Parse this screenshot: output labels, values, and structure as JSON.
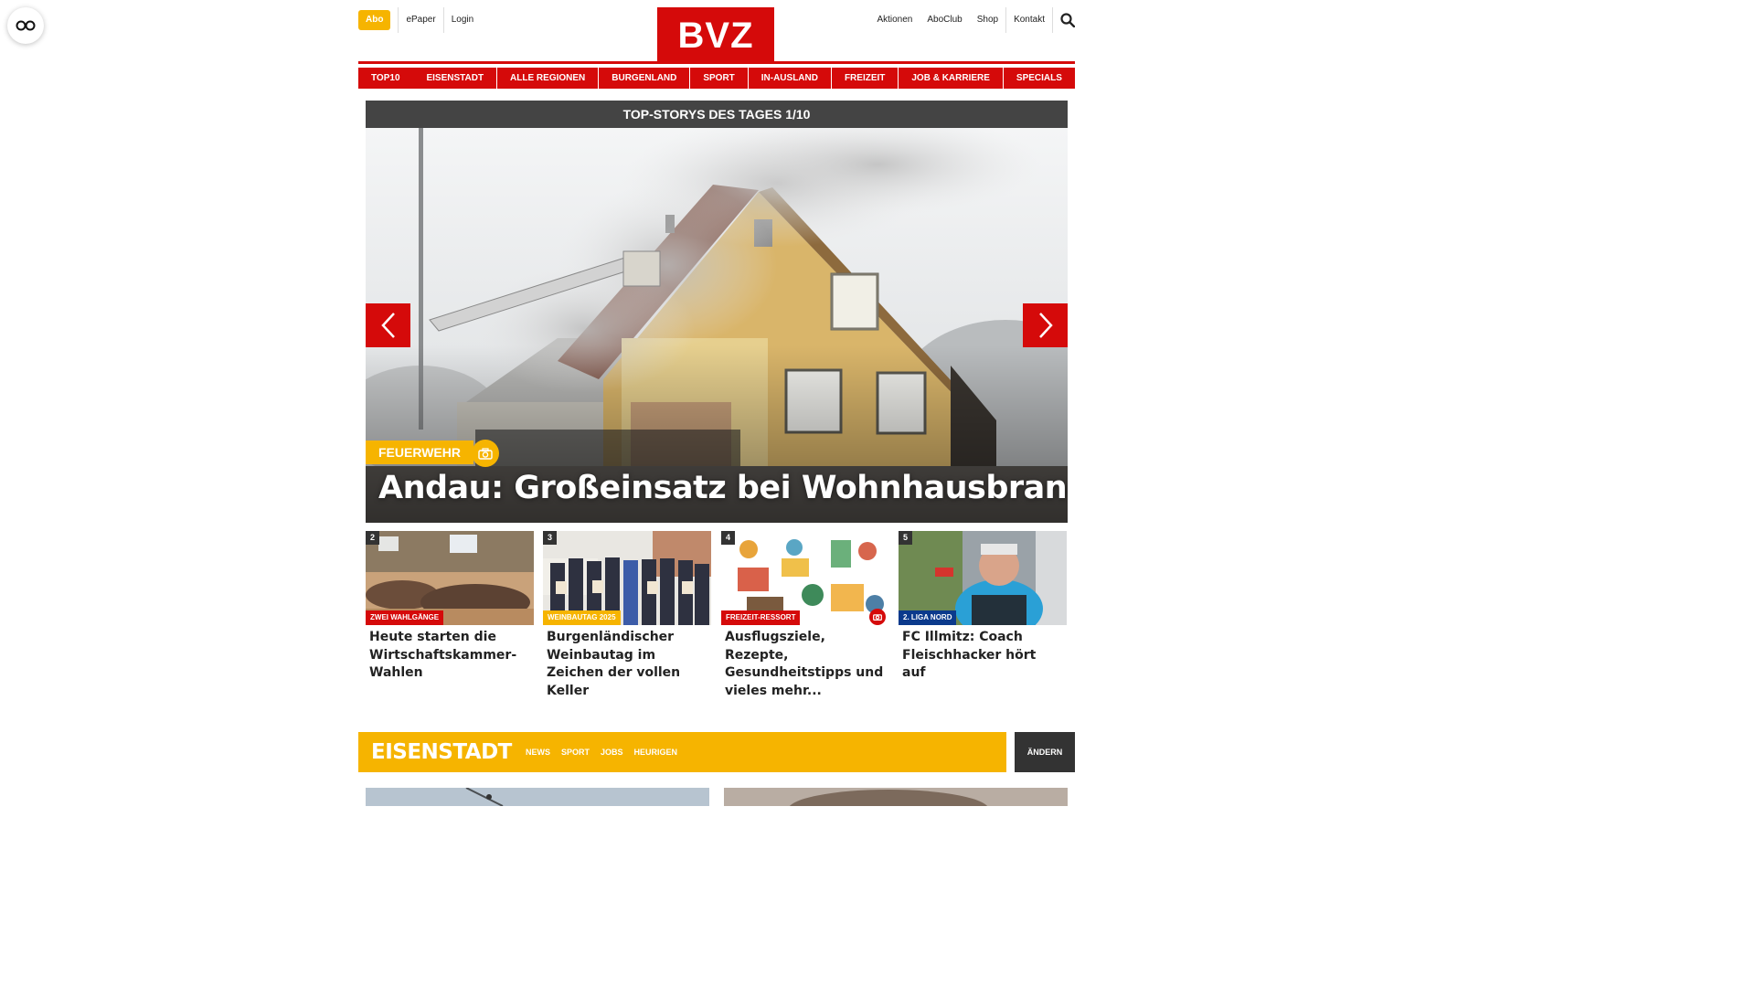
{
  "header": {
    "abo_label": "Abo",
    "epaper_label": "ePaper",
    "login_label": "Login",
    "logo_text": "BVZ",
    "right_links": [
      "Aktionen",
      "AboClub",
      "Shop",
      "Kontakt"
    ]
  },
  "nav": {
    "items": [
      "TOP10",
      "EISENSTADT",
      "ALLE REGIONEN",
      "BURGENLAND",
      "SPORT",
      "IN-AUSLAND",
      "FREIZEIT",
      "JOB & KARRIERE",
      "SPECIALS"
    ]
  },
  "topstories": {
    "heading": "TOP-STORYS DES TAGES 1/10",
    "hero": {
      "category": "FEUERWEHR",
      "title": "Andau: Großeinsatz bei Wohnhausbrand",
      "camera_icon": "camera-icon"
    },
    "teasers": [
      {
        "num": "2",
        "category": "ZWEI WAHLGÄNGE",
        "cat_color": "#d50a0a",
        "title": "Heute starten die Wirtschaftskammer-Wahlen"
      },
      {
        "num": "3",
        "category": "WEINBAUTAG 2025",
        "cat_color": "#f6b400",
        "title": "Burgenländischer Weinbautag im Zeichen der vollen Keller"
      },
      {
        "num": "4",
        "category": "FREIZEIT-RESSORT",
        "cat_color": "#d50a0a",
        "title": "Ausflugsziele, Rezepte, Gesundheitstipps und vieles mehr..."
      },
      {
        "num": "5",
        "category": "2. LIGA NORD",
        "cat_color": "#0b3a8c",
        "title": "FC Illmitz: Coach Fleischhacker hört auf"
      }
    ]
  },
  "region": {
    "title": "EISENSTADT",
    "links": [
      "NEWS",
      "SPORT",
      "JOBS",
      "HEURIGEN"
    ],
    "change_label": "ÄNDERN"
  },
  "colors": {
    "brand_red": "#d50a0a",
    "accent_yellow": "#f6b400",
    "dark_bar": "#444444"
  }
}
